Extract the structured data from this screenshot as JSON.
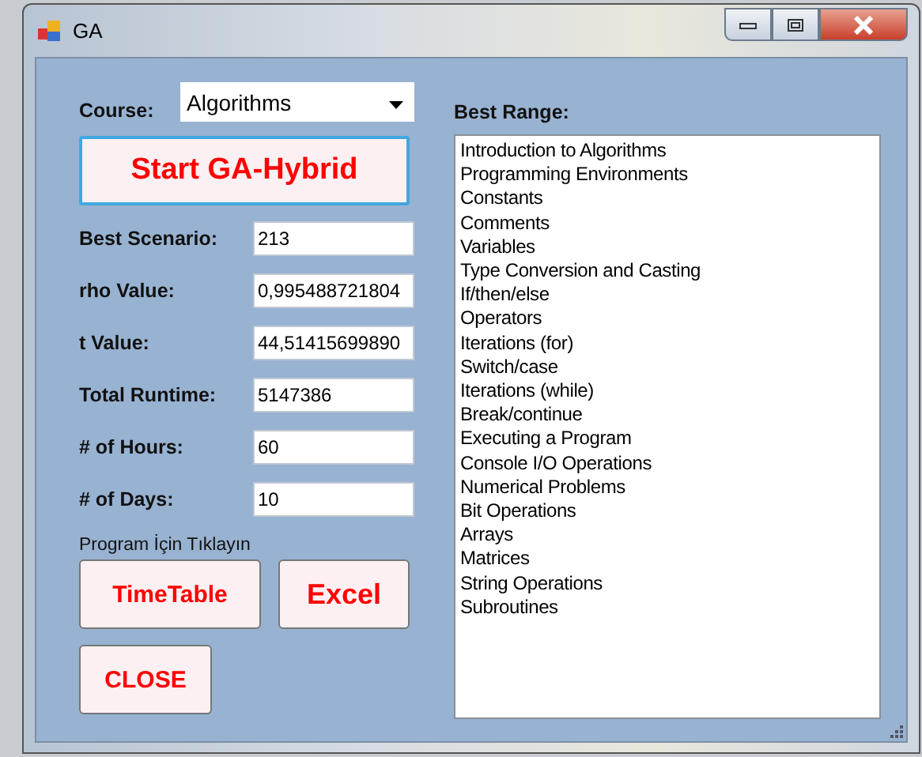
{
  "window": {
    "title": "GA"
  },
  "course": {
    "label": "Course:",
    "value": "Algorithms"
  },
  "start_button": "Start GA-Hybrid",
  "fields": [
    {
      "label": "Best Scenario:",
      "value": "213"
    },
    {
      "label": "rho Value:",
      "value": "0,995488721804"
    },
    {
      "label": "t Value:",
      "value": "44,51415699890"
    },
    {
      "label": "Total Runtime:",
      "value": "5147386"
    },
    {
      "label": "# of Hours:",
      "value": "60"
    },
    {
      "label": "# of Days:",
      "value": "10"
    }
  ],
  "hint": "Program İçin Tıklayın",
  "buttons": [
    {
      "label": "TimeTable",
      "kind": "small"
    },
    {
      "label": "Excel",
      "kind": "large"
    },
    {
      "label": "CLOSE",
      "kind": "small"
    }
  ],
  "best_range": {
    "label": "Best Range:",
    "items": [
      "Introduction to Algorithms",
      "Programming Environments",
      "Constants",
      "Comments",
      "Variables",
      "Type Conversion and Casting",
      "If/then/else",
      "Operators",
      "Iterations (for)",
      "Switch/case",
      "Iterations (while)",
      "Break/continue",
      "Executing a Program",
      "Console I/O Operations",
      "Numerical Problems",
      "Bit Operations",
      "Arrays",
      "Matrices",
      "String Operations",
      "Subroutines"
    ]
  }
}
